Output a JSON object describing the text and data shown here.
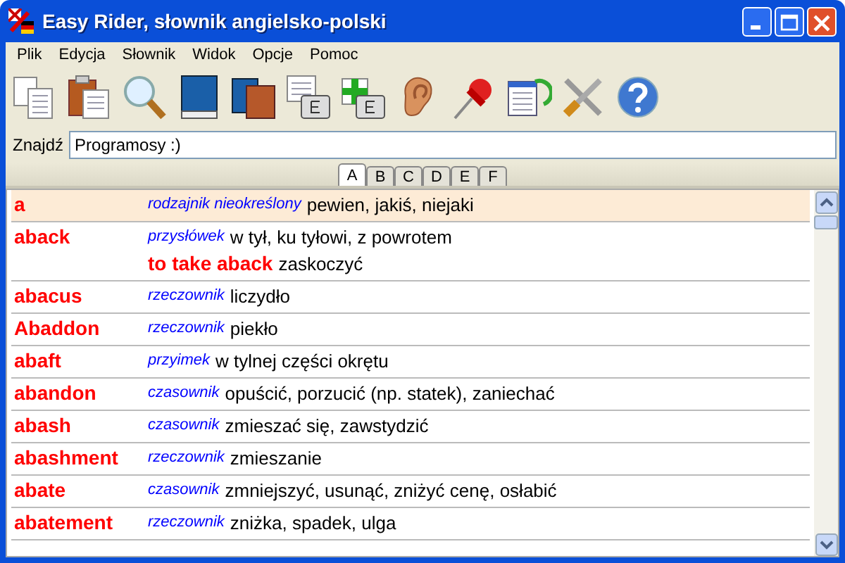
{
  "window": {
    "title": "Easy Rider, słownik angielsko-polski"
  },
  "menu": [
    "Plik",
    "Edycja",
    "Słownik",
    "Widok",
    "Opcje",
    "Pomoc"
  ],
  "toolbar": [
    {
      "kind": "copy"
    },
    {
      "kind": "paste"
    },
    {
      "kind": "search"
    },
    {
      "kind": "book"
    },
    {
      "kind": "books"
    },
    {
      "kind": "doc-key"
    },
    {
      "kind": "add-key"
    },
    {
      "kind": "ear"
    },
    {
      "kind": "pin"
    },
    {
      "kind": "refresh"
    },
    {
      "kind": "tools"
    },
    {
      "kind": "help"
    }
  ],
  "search": {
    "label": "Znajdź",
    "value": "Programosy :)"
  },
  "letter_tabs": [
    {
      "label": "A",
      "selected": true
    },
    {
      "label": "B",
      "selected": false
    },
    {
      "label": "C",
      "selected": false
    },
    {
      "label": "D",
      "selected": false
    },
    {
      "label": "E",
      "selected": false
    },
    {
      "label": "F",
      "selected": false
    }
  ],
  "entries": [
    {
      "word": "a",
      "pos": "rodzajnik nieokreślony",
      "meaning": "pewien, jakiś, niejaki",
      "selected": true
    },
    {
      "word": "aback",
      "pos": "przysłówek",
      "meaning": "w tył, ku tyłowi, z powrotem",
      "selected": false,
      "phrases": [
        {
          "phrase": "to take aback",
          "meaning": "zaskoczyć"
        }
      ]
    },
    {
      "word": "abacus",
      "pos": "rzeczownik",
      "meaning": "liczydło",
      "selected": false
    },
    {
      "word": "Abaddon",
      "pos": "rzeczownik",
      "meaning": "piekło",
      "selected": false
    },
    {
      "word": "abaft",
      "pos": "przyimek",
      "meaning": "w tylnej części okrętu",
      "selected": false
    },
    {
      "word": "abandon",
      "pos": "czasownik",
      "meaning": "opuścić, porzucić (np. statek), zaniechać",
      "selected": false
    },
    {
      "word": "abash",
      "pos": "czasownik",
      "meaning": "zmieszać się, zawstydzić",
      "selected": false
    },
    {
      "word": "abashment",
      "pos": "rzeczownik",
      "meaning": "zmieszanie",
      "selected": false
    },
    {
      "word": "abate",
      "pos": "czasownik",
      "meaning": "zmniejszyć, usunąć, zniżyć cenę, osłabić",
      "selected": false
    },
    {
      "word": "abatement",
      "pos": "rzeczownik",
      "meaning": "zniżka, spadek, ulga",
      "selected": false
    }
  ]
}
